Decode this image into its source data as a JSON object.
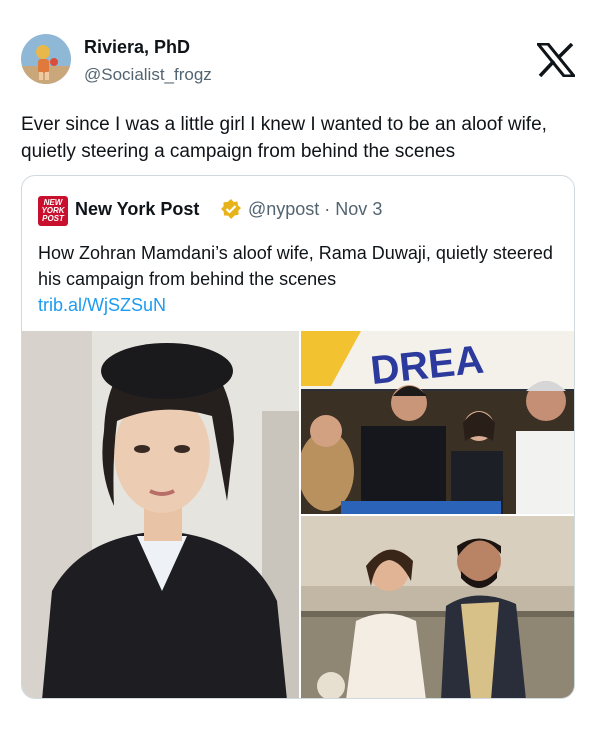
{
  "author": {
    "name": "Riviera, PhD",
    "handle": "@Socialist_frogz",
    "avatar_icon": "frog-avatar-icon"
  },
  "platform_icon": "x-logo-icon",
  "tweet": {
    "text": "Ever since I was a little girl I knew I wanted to be an aloof wife, quietly steering a campaign from behind the scenes"
  },
  "quote": {
    "source_logo_text": "NEW YORK POST",
    "source_name": "New York Post",
    "verified_badge_color": "#e8b21b",
    "handle_date": "@nypost · Nov 3",
    "text": "How Zohran Mamdani’s aloof wife, Rama Duwaji, quietly steered his campaign from behind the scenes",
    "link": "trib.al/WjSZSuN",
    "image_banner_text": "DREA"
  },
  "colors": {
    "link": "#1d9bf0",
    "secondary_text": "#536471",
    "border": "#cfd9de",
    "nypost_red": "#c8102e"
  }
}
